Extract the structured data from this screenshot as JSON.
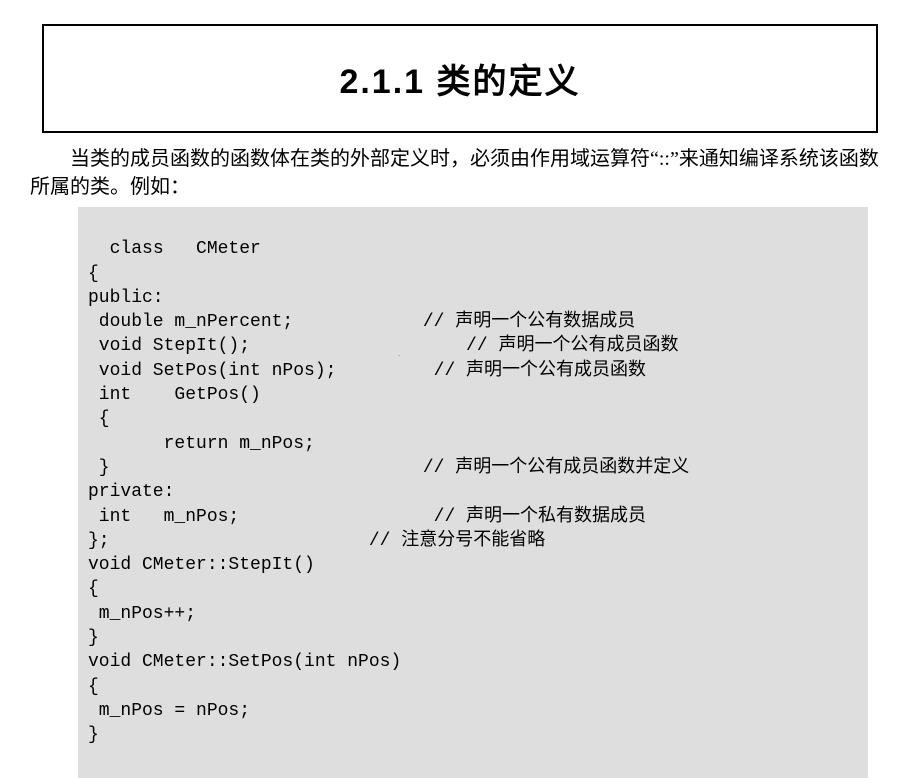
{
  "title": "2.1.1  类的定义",
  "intro": "当类的成员函数的函数体在类的外部定义时，必须由作用域运算符“::”来通知编译系统该函数所属的类。例如：",
  "code": "class   CMeter\n{\npublic:\n double m_nPercent;            // 声明一个公有数据成员\n void StepIt();                    // 声明一个公有成员函数\n void SetPos(int nPos);         // 声明一个公有成员函数\n int    GetPos()\n {\n       return m_nPos;\n }                             // 声明一个公有成员函数并定义\nprivate:\n int   m_nPos;                  // 声明一个私有数据成员\n};                        // 注意分号不能省略\nvoid CMeter::StepIt()\n{\n m_nPos++;\n}\nvoid CMeter::SetPos(int nPos)\n{\n m_nPos = nPos;\n}",
  "page_marker": "."
}
